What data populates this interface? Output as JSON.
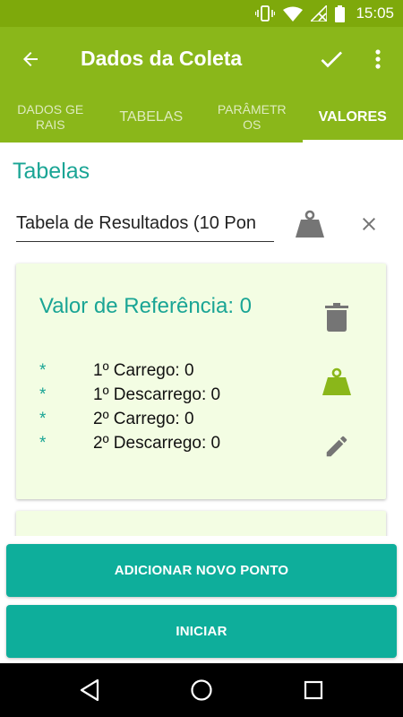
{
  "status_bar": {
    "time": "15:05",
    "icons": [
      "vibrate-icon",
      "wifi-icon",
      "no-signal-icon",
      "battery-icon"
    ]
  },
  "app_bar": {
    "title": "Dados da Coleta",
    "icons": [
      "back-arrow-icon",
      "check-icon",
      "more-vert-icon"
    ]
  },
  "tabs": [
    {
      "label": "DADOS GERAIS",
      "active": false
    },
    {
      "label": "TABELAS",
      "active": false
    },
    {
      "label": "PARÂMETROS",
      "active": false
    },
    {
      "label": "VALORES",
      "active": true
    }
  ],
  "content": {
    "section_title": "Tabelas",
    "table_select": {
      "value": "Tabela de Resultados (10 Pon"
    },
    "card": {
      "title": "Valor de  Referência: 0",
      "bullet": "*",
      "items": [
        {
          "label": "1º Carrego: 0"
        },
        {
          "label": "1º Descarrego: 0"
        },
        {
          "label": "2º Carrego: 0"
        },
        {
          "label": "2º Descarrego: 0"
        }
      ]
    }
  },
  "buttons": {
    "add_point": "ADICIONAR NOVO PONTO",
    "start": "INICIAR"
  },
  "colors": {
    "status_bar": "#7ea90b",
    "app_bar": "#8ab71a",
    "accent": "#1aa595",
    "button": "#0eae9b",
    "card_bg": "#f3fde3",
    "weight_active": "#8ab71a",
    "icon_gray": "#757575"
  }
}
